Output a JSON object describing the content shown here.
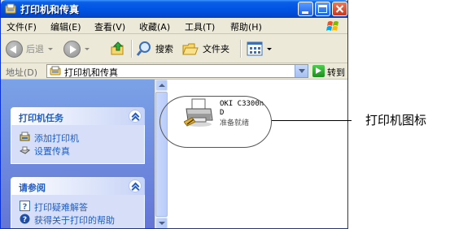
{
  "window": {
    "title": "打印机和传真",
    "title_icon": "printers-folder-icon"
  },
  "menu": [
    {
      "label": "文件(F)"
    },
    {
      "label": "编辑(E)"
    },
    {
      "label": "查看(V)"
    },
    {
      "label": "收藏(A)"
    },
    {
      "label": "工具(T)"
    },
    {
      "label": "帮助(H)"
    }
  ],
  "toolbar": {
    "back_label": "后退",
    "search_label": "搜索",
    "folders_label": "文件夹"
  },
  "address": {
    "label": "地址(D)",
    "value": "打印机和传真",
    "go_label": "转到"
  },
  "sidebar": {
    "printer_tasks": {
      "title": "打印机任务",
      "items": [
        {
          "label": "添加打印机",
          "icon": "add-printer-icon"
        },
        {
          "label": "设置传真",
          "icon": "fax-icon"
        }
      ]
    },
    "see_also": {
      "title": "请参阅",
      "items": [
        {
          "label": "打印疑难解答",
          "icon": "help-question-icon"
        },
        {
          "label": "获得关于打印的帮助",
          "icon": "help-circle-icon"
        }
      ]
    }
  },
  "printer": {
    "name": "OKI C3300n",
    "name_suffix": "D",
    "status": "准备就绪"
  },
  "callout": {
    "text": "打印机图标"
  },
  "colors": {
    "titlebar": "#0054e3",
    "taskpane": "#7ba2e7",
    "panel_link": "#215dc6"
  }
}
